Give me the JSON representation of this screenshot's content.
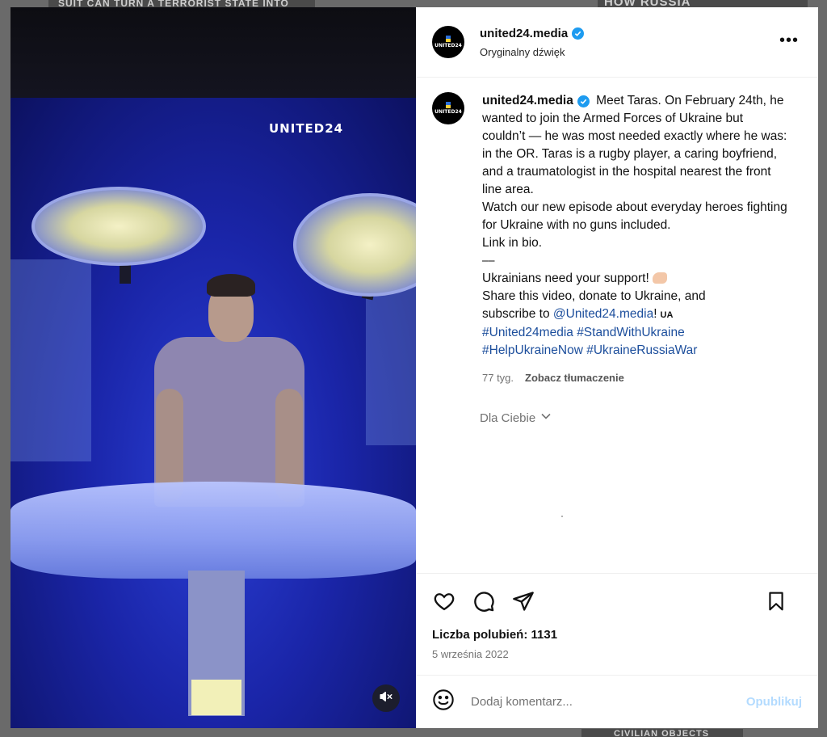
{
  "background": {
    "tile_texts": [
      "SUIT CAN TURN A TERRORIST STATE INTO",
      "HOW RUSSIA",
      "CIVILIAN OBJECTS"
    ]
  },
  "video": {
    "watermark": "UNITED24",
    "mute_icon": "speaker-muted-icon"
  },
  "post_header": {
    "avatar_text": "UNITED24",
    "username": "united24.media",
    "verified": true,
    "audio_label": "Oryginalny dźwięk",
    "more_icon": "more-options-icon"
  },
  "caption": {
    "username": "united24.media",
    "paragraph_1": "Meet Taras. On February 24th, he wanted to join the Armed Forces of Ukraine but couldn’t — he was most needed exactly where he was: in the OR. Taras is a rugby player, a caring boyfriend, and a traumatologist in the hospital nearest the front line area.",
    "paragraph_2": "Watch our new episode about everyday heroes fighting for Ukraine with no guns included.",
    "paragraph_3": "Link in bio.",
    "separator": "⎯⎯",
    "support_line": "Ukrainians need your support!",
    "share_line": "Share this video, donate to Ukraine, and",
    "subscribe_prefix": "subscribe to ",
    "mention": "@United24.media",
    "subscribe_suffix": "!",
    "ua_badge": "UA",
    "hashtags_line_1": "#United24media #StandWithUkraine",
    "hashtags_line_2": "#HelpUkraineNow #UkraineRussiaWar",
    "age": "77 tyg.",
    "translate": "Zobacz tłumaczenie",
    "for_you": "Dla Ciebie"
  },
  "actions": {
    "like_icon": "heart-icon",
    "comment_icon": "comment-icon",
    "share_icon": "send-icon",
    "save_icon": "bookmark-icon"
  },
  "likes_label": "Liczba polubień: 1131",
  "date": "5 września 2022",
  "comment": {
    "emoji_icon": "emoji-icon",
    "placeholder": "Dodaj komentarz...",
    "publish": "Opublikuj"
  }
}
